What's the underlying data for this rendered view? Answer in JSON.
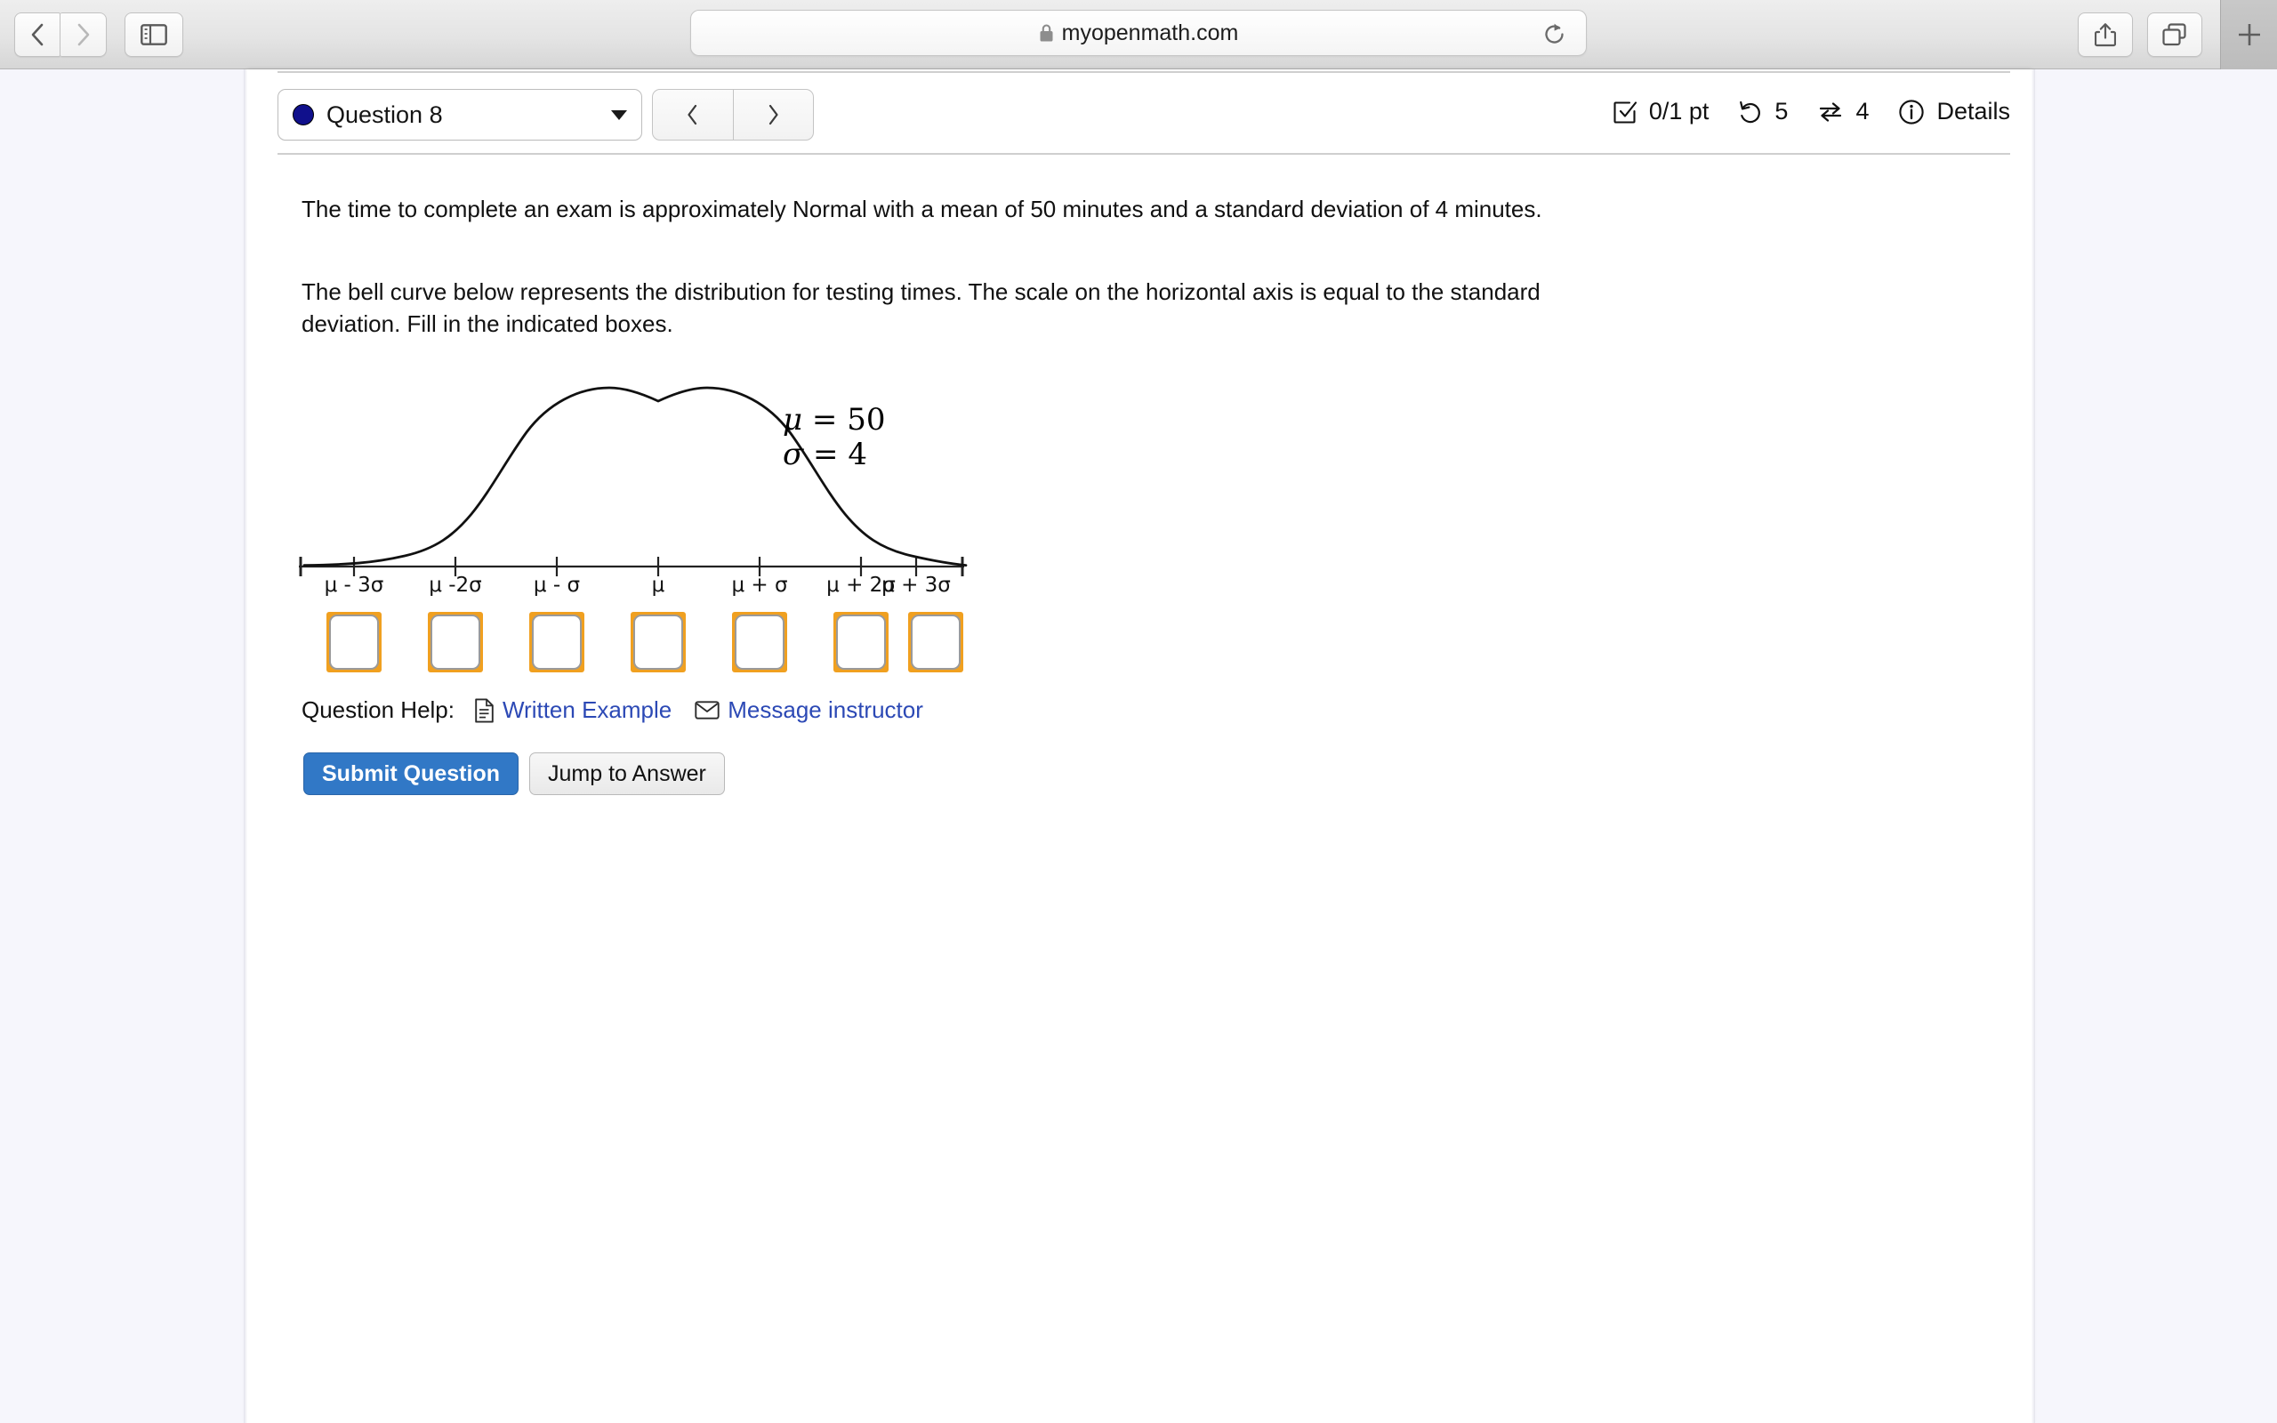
{
  "browser": {
    "back_icon": "chevron-left-icon",
    "forward_icon": "chevron-right-icon",
    "sidebar_icon": "sidebar-toggle-icon",
    "share_icon": "share-icon",
    "tabs_icon": "tabs-icon",
    "new_tab_label": "+",
    "url": "myopenmath.com",
    "lock_icon": "lock-icon",
    "reload_icon": "reload-icon"
  },
  "header": {
    "question_label": "Question 8",
    "dot_color": "#10108c",
    "caret_icon": "chevron-down-icon",
    "prev_icon": "chevron-left-icon",
    "next_icon": "chevron-right-icon",
    "status": {
      "score_icon": "checkbox-icon",
      "score": "0/1 pt",
      "attempts_icon": "undo-icon",
      "attempts": "5",
      "versions_icon": "swap-icon",
      "versions": "4",
      "details_icon": "info-icon",
      "details_label": "Details"
    }
  },
  "question": {
    "paragraph_1": "The time to complete an exam is approximately Normal with a mean of 50 minutes and a standard deviation of 4 minutes.",
    "paragraph_2": "The bell curve below represents the distribution for testing times. The scale on the horizontal axis is equal to the standard deviation. Fill in the indicated boxes.",
    "mu_label": "μ",
    "mu_eq": " = ",
    "mu_value": "50",
    "sigma_label": "σ",
    "sigma_eq": " = ",
    "sigma_value": "4"
  },
  "chart_data": {
    "type": "line",
    "title": "",
    "xlabel": "",
    "ylabel": "",
    "curve": "normal-bell-curve",
    "mean": 50,
    "sd": 4,
    "xlim": [
      -3.6,
      3.6
    ],
    "ylim": [
      0,
      1
    ],
    "grid": false,
    "legend": "none",
    "tick_positions": [
      -3,
      -2,
      -1,
      0,
      1,
      2,
      3
    ],
    "tick_labels": [
      "μ - 3σ",
      "μ -2σ",
      "μ - σ",
      "μ",
      "μ + σ",
      "μ + 2σ",
      "μ + 3σ"
    ],
    "curve_y_values": [
      0.011,
      0.022,
      0.044,
      0.082,
      0.144,
      0.236,
      0.361,
      0.52,
      0.698,
      0.865,
      0.975,
      1.0,
      0.975,
      0.865,
      0.698,
      0.52,
      0.361,
      0.236,
      0.144,
      0.082,
      0.044,
      0.022,
      0.011
    ],
    "answer_box_count": 7,
    "answer_box_values": [
      "",
      "",
      "",
      "",
      "",
      "",
      ""
    ],
    "answer_box_border_color": "#f0a020"
  },
  "help": {
    "label": "Question Help:",
    "written_example_icon": "document-icon",
    "written_example": "Written Example",
    "message_icon": "envelope-icon",
    "message_instructor": "Message instructor",
    "link_color": "#2c49b5"
  },
  "actions": {
    "submit_label": "Submit Question",
    "submit_color": "#3178c6",
    "jump_label": "Jump to Answer"
  }
}
